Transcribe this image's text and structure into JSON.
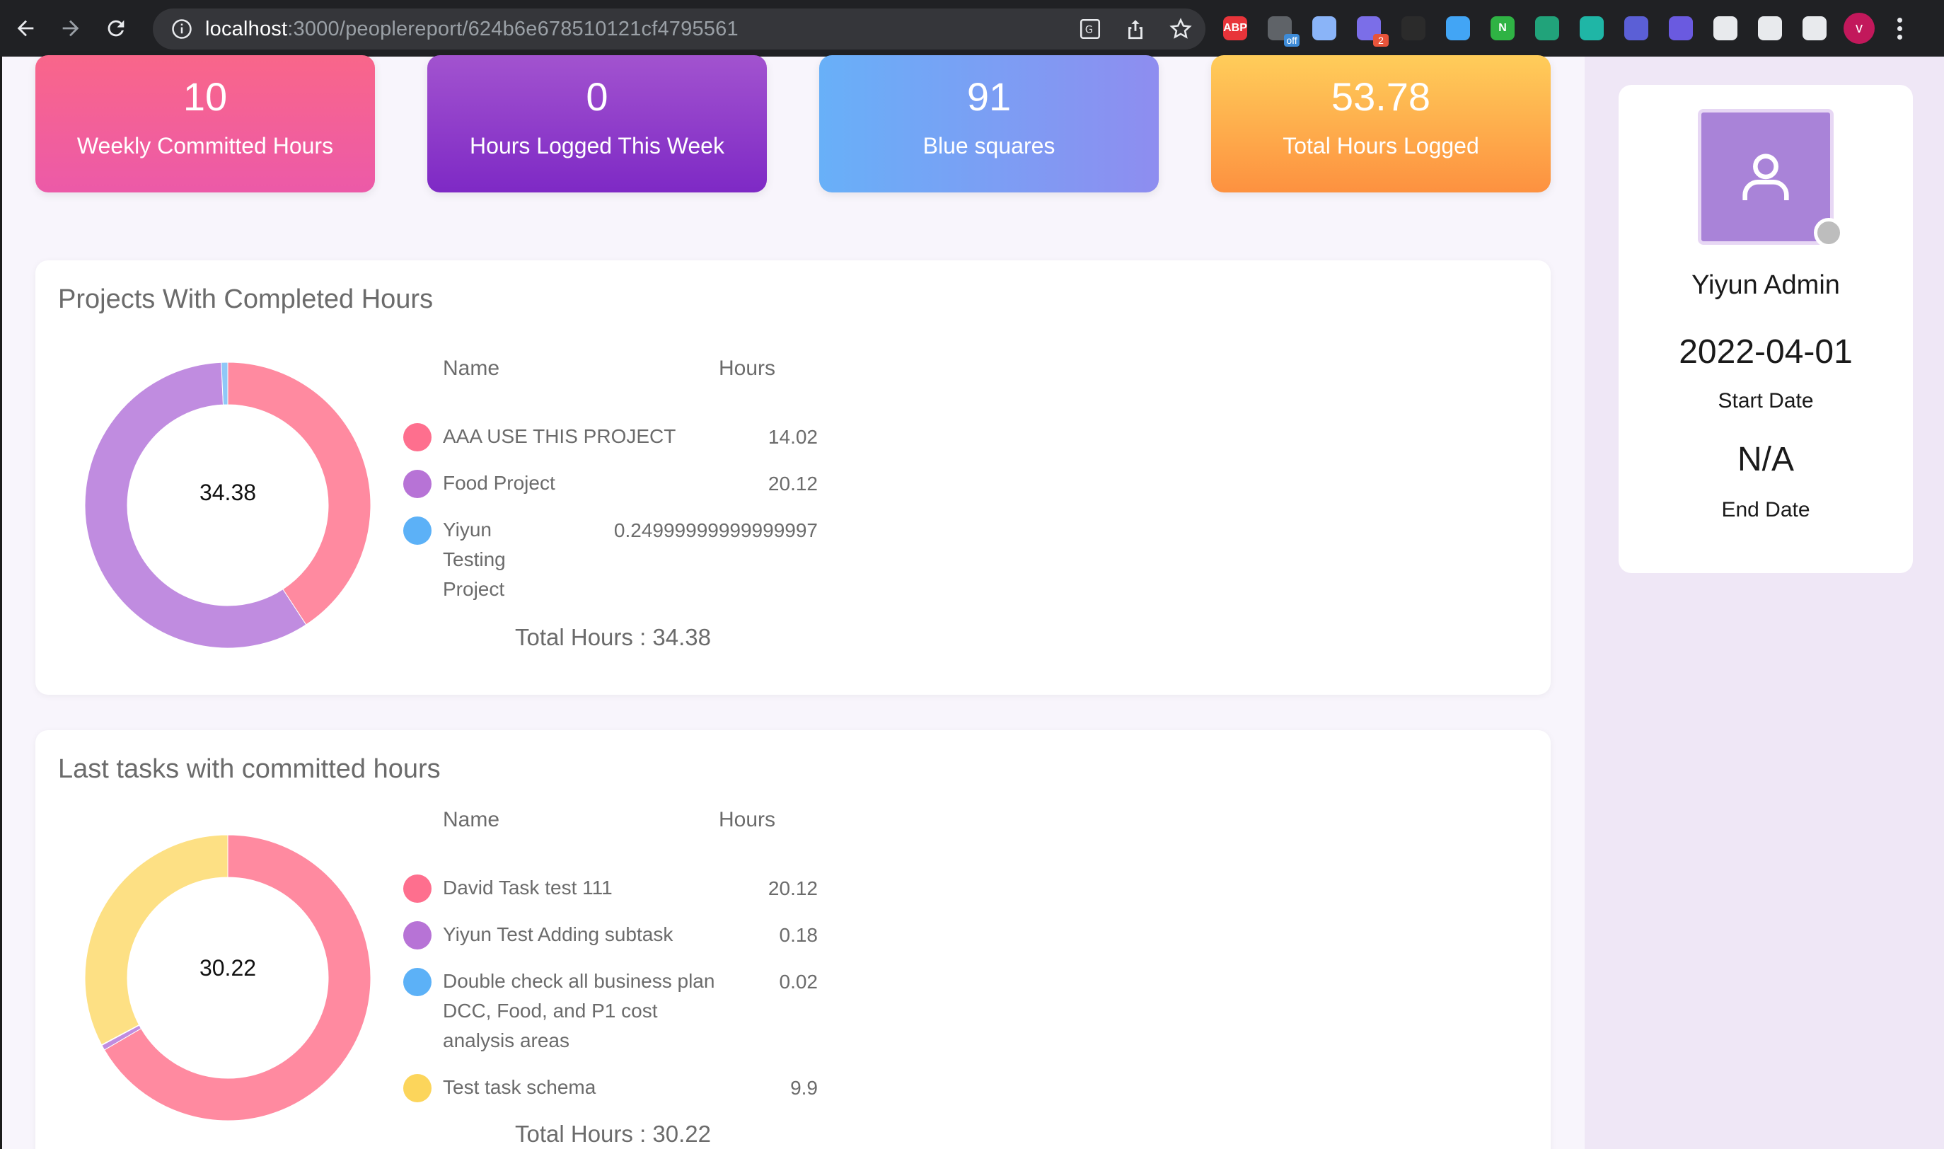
{
  "browser": {
    "url_host": "localhost",
    "url_path": ":3000/peoplereport/624b6e678510121cf4795561",
    "extensions": [
      {
        "icon": "adblock-icon",
        "text": "ABP",
        "color": "#e8343a"
      },
      {
        "icon": "flag-off-icon",
        "text": "",
        "badge": "off",
        "color": "#5f6368"
      },
      {
        "icon": "files-icon",
        "text": "",
        "color": "#8ab4f8"
      },
      {
        "icon": "puzzle-burst-icon",
        "text": "",
        "badge": "2",
        "color": "#7b6ee8"
      },
      {
        "icon": "cube-icon",
        "text": "",
        "color": "#2b2b2b"
      },
      {
        "icon": "forward-icon",
        "text": "",
        "color": "#42a5f5"
      },
      {
        "icon": "n-icon",
        "text": "N",
        "color": "#2fb344"
      },
      {
        "icon": "hex-icon",
        "text": "",
        "color": "#21a37a"
      },
      {
        "icon": "chat-icon",
        "text": "",
        "color": "#1fb6a6"
      },
      {
        "icon": "globe-icon",
        "text": "",
        "color": "#5b5fd6"
      },
      {
        "icon": "color-picker-icon",
        "text": "",
        "color": "#6a5ae0"
      },
      {
        "icon": "extensions-icon",
        "text": "",
        "color": "#e8eaed"
      },
      {
        "icon": "reading-list-icon",
        "text": "",
        "color": "#e8eaed"
      },
      {
        "icon": "side-panel-icon",
        "text": "",
        "color": "#e8eaed"
      }
    ],
    "profile_initial": "v"
  },
  "stats": [
    {
      "value": "10",
      "label": "Weekly Committed Hours"
    },
    {
      "value": "0",
      "label": "Hours Logged This Week"
    },
    {
      "value": "91",
      "label": "Blue squares"
    },
    {
      "value": "53.78",
      "label": "Total Hours Logged"
    }
  ],
  "projects": {
    "title": "Projects With Completed Hours",
    "col_name": "Name",
    "col_hours": "Hours",
    "center_label": "34.38",
    "total_label": "Total Hours : 34.38",
    "items": [
      {
        "name": "AAA USE THIS PROJECT",
        "hours": "14.02",
        "color": "#fe6f8e"
      },
      {
        "name": "Food Project",
        "hours": "20.12",
        "color": "#b773d6"
      },
      {
        "name": "Yiyun Testing Project",
        "hours": "0.24999999999999997",
        "color": "#5cb1f7"
      }
    ]
  },
  "tasks": {
    "title": "Last tasks with committed hours",
    "col_name": "Name",
    "col_hours": "Hours",
    "center_label": "30.22",
    "total_label": "Total Hours : 30.22",
    "items": [
      {
        "name": "David Task test 111",
        "hours": "20.12",
        "color": "#fe6f8e"
      },
      {
        "name": "Yiyun Test Adding subtask",
        "hours": "0.18",
        "color": "#b773d6"
      },
      {
        "name": "Double check all business plan DCC, Food, and P1 cost analysis areas",
        "hours": "0.02",
        "color": "#5cb1f7"
      },
      {
        "name": "Test task schema",
        "hours": "9.9",
        "color": "#fcd55b"
      }
    ]
  },
  "profile": {
    "name": "Yiyun Admin",
    "start_date": "2022-04-01",
    "start_label": "Start Date",
    "end_date": "N/A",
    "end_label": "End Date"
  },
  "chart_data": [
    {
      "type": "pie",
      "categories": [
        "AAA USE THIS PROJECT",
        "Food Project",
        "Yiyun Testing Project"
      ],
      "values": [
        14.02,
        20.12,
        0.25
      ],
      "colors": [
        "#ff8aa0",
        "#c08ce0",
        "#8fc8f7"
      ]
    },
    {
      "type": "pie",
      "categories": [
        "David Task test 111",
        "Yiyun Test Adding subtask",
        "Double check all business plan DCC, Food, and P1 cost analysis areas",
        "Test task schema"
      ],
      "values": [
        20.12,
        0.18,
        0.02,
        9.9
      ],
      "colors": [
        "#ff8aa0",
        "#c08ce0",
        "#8fc8f7",
        "#fde084"
      ]
    }
  ]
}
